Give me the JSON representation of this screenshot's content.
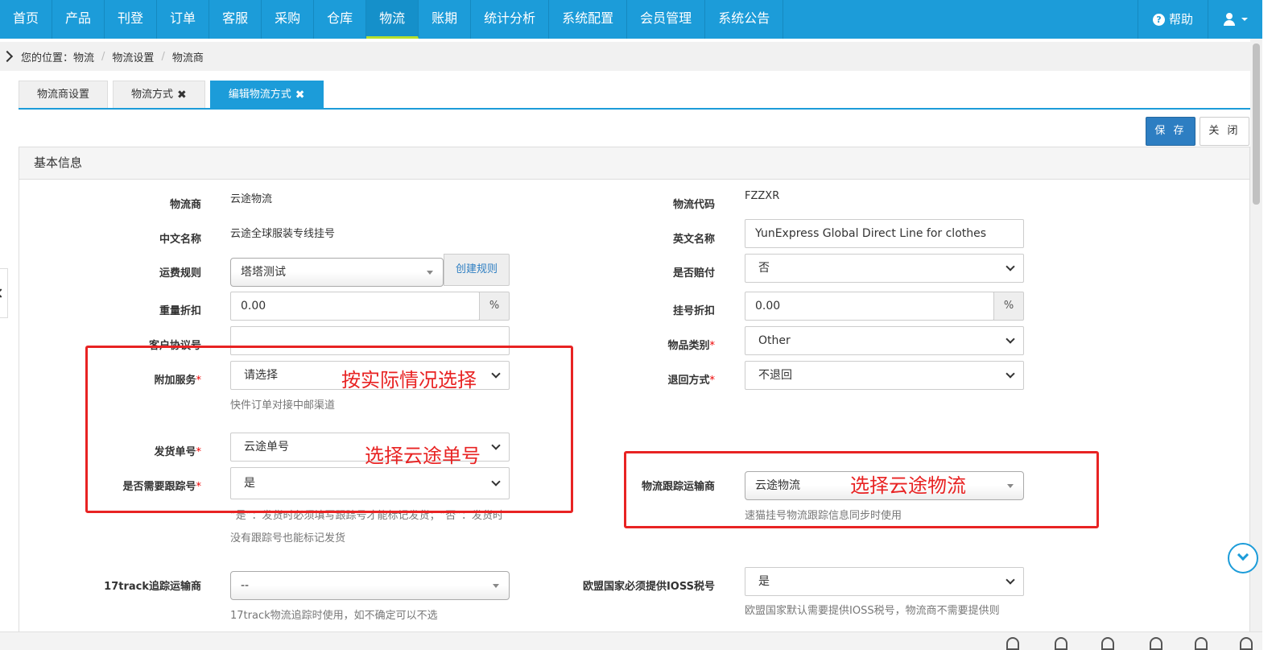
{
  "nav": {
    "items": [
      "首页",
      "产品",
      "刊登",
      "订单",
      "客服",
      "采购",
      "仓库",
      "物流",
      "账期",
      "统计分析",
      "系统配置",
      "会员管理",
      "系统公告"
    ],
    "active": "物流",
    "help_icon": "question-circle-icon",
    "help_label": "帮助",
    "user_icon": "user-icon"
  },
  "breadcrumb": {
    "prefix": "您的位置：",
    "items": [
      "物流",
      "物流设置",
      "物流商"
    ]
  },
  "tabs": [
    {
      "label": "物流商设置",
      "closable": false
    },
    {
      "label": "物流方式",
      "closable": true
    },
    {
      "label": "编辑物流方式",
      "closable": true,
      "active": true
    }
  ],
  "tab_close_glyph": "✖",
  "actions": {
    "save": "保 存",
    "close": "关 闭"
  },
  "panel": {
    "title": "基本信息",
    "left": {
      "carrier": {
        "label": "物流商",
        "value": "云途物流"
      },
      "cn_name": {
        "label": "中文名称",
        "value": "云途全球服装专线挂号"
      },
      "freight_rule": {
        "label": "运费规则",
        "value": "塔塔测试",
        "addon": "创建规则"
      },
      "weight_discount": {
        "label": "重量折扣",
        "value": "0.00",
        "addon": "%"
      },
      "customer_agreement": {
        "label": "客户协议号",
        "value": ""
      },
      "extra_service": {
        "label": "附加服务",
        "required": "*",
        "placeholder": "请选择",
        "hint": "快件订单对接中邮渠道"
      },
      "ship_no": {
        "label": "发货单号",
        "required": "*",
        "value": "云途单号"
      },
      "need_tracking": {
        "label": "是否需要跟踪号",
        "required": "*",
        "value": "是",
        "hint": "“是”：发货时必须填写跟踪号才能标记发货；“否”：发货时没有跟踪号也能标记发货"
      },
      "track17": {
        "label": "17track追踪运输商",
        "value": "--",
        "hint": "17track物流追踪时使用，如不确定可以不选"
      }
    },
    "right": {
      "code": {
        "label": "物流代码",
        "value": "FZZXR"
      },
      "en_name": {
        "label": "英文名称",
        "value": "YunExpress Global Direct Line for clothes"
      },
      "compensation": {
        "label": "是否赔付",
        "value": "否"
      },
      "reg_discount": {
        "label": "挂号折扣",
        "value": "0.00",
        "addon": "%"
      },
      "item_category": {
        "label": "物品类别",
        "required": "*",
        "value": "Other"
      },
      "return_method": {
        "label": "退回方式",
        "required": "*",
        "value": "不退回"
      },
      "tracking_carrier": {
        "label": "物流跟踪运输商",
        "value": "云途物流",
        "hint": "速猫挂号物流跟踪信息同步时使用"
      },
      "ioss": {
        "label": "欧盟国家必须提供IOSS税号",
        "value": "是",
        "hint": "欧盟国家默认需要提供IOSS税号，物流商不需要提供则"
      }
    }
  },
  "annotations": {
    "select_actual": "按实际情况选择",
    "select_yuntu_no": "选择云途单号",
    "select_yuntu_logistics": "选择云途物流"
  },
  "colors": {
    "nav": "#1c9cd9",
    "primary": "#2d7ec2",
    "annotation": "#e82323",
    "active_underline": "#b5e02d"
  }
}
